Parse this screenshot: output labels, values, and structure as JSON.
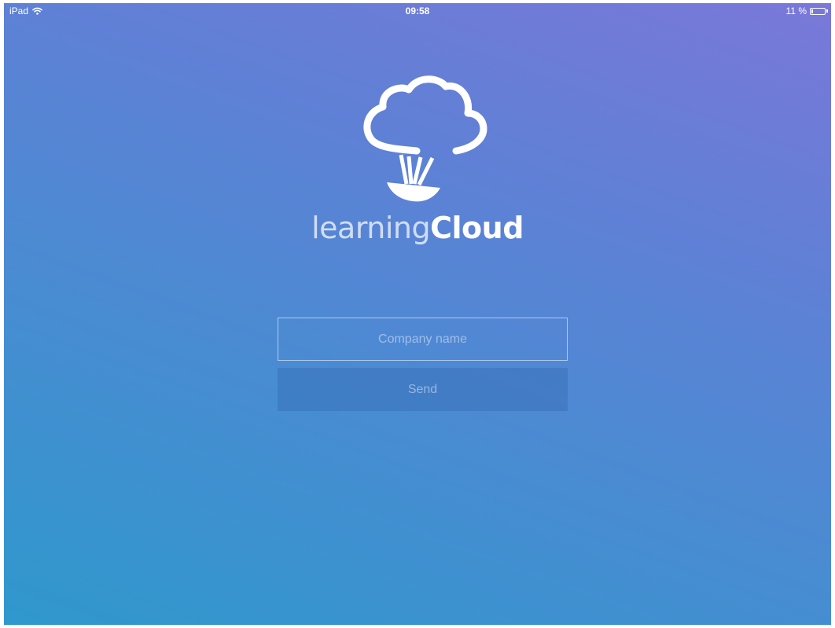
{
  "status_bar": {
    "device": "iPad",
    "time": "09:58",
    "battery": "11 %",
    "battery_level": 0.11,
    "wifi_icon": "wifi-icon",
    "battery_icon": "battery-icon"
  },
  "brand": {
    "logo_icon": "cloud-balloon-logo",
    "name_light": "learning",
    "name_bold": "Cloud"
  },
  "form": {
    "company_placeholder": "Company name",
    "company_value": "",
    "send_label": "Send"
  },
  "colors": {
    "gradient_start": "#2f98cc",
    "gradient_end": "#7a78d8",
    "text": "#ffffff"
  }
}
